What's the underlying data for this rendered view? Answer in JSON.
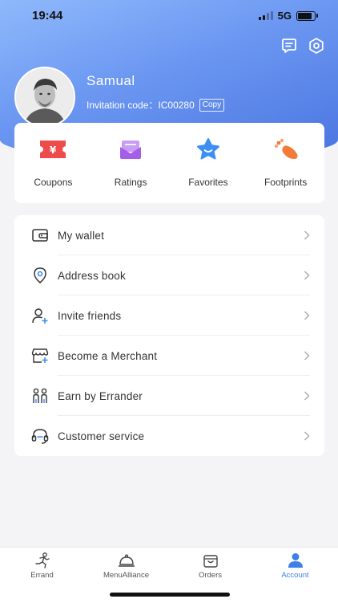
{
  "status_bar": {
    "time": "19:44",
    "network": "5G"
  },
  "header": {
    "top_icons": [
      "message-icon",
      "settings-icon"
    ],
    "username": "Samual",
    "invitation_label": "Invitation code：",
    "invitation_code": "IC00280",
    "copy_label": "Copy"
  },
  "quick_actions": [
    {
      "label": "Coupons",
      "icon": "coupon-icon"
    },
    {
      "label": "Ratings",
      "icon": "ratings-envelope-icon"
    },
    {
      "label": "Favorites",
      "icon": "favorites-star-icon"
    },
    {
      "label": "Footprints",
      "icon": "footprints-icon"
    }
  ],
  "menu": [
    {
      "label": "My wallet",
      "icon": "wallet-icon"
    },
    {
      "label": "Address book",
      "icon": "location-pin-icon"
    },
    {
      "label": "Invite friends",
      "icon": "invite-user-icon"
    },
    {
      "label": "Become a Merchant",
      "icon": "merchant-store-icon"
    },
    {
      "label": "Earn by Errander",
      "icon": "errander-people-icon"
    },
    {
      "label": "Customer service",
      "icon": "headset-icon"
    }
  ],
  "tabs": [
    {
      "label": "Errand",
      "icon": "runner-icon",
      "active": false
    },
    {
      "label": "MenuAlliance",
      "icon": "cloche-icon",
      "active": false
    },
    {
      "label": "Orders",
      "icon": "shopping-bag-icon",
      "active": false
    },
    {
      "label": "Account",
      "icon": "account-user-icon",
      "active": true
    }
  ],
  "colors": {
    "header_gradient_start": "#8fb9fb",
    "header_gradient_end": "#4a74e0",
    "active_tab": "#3f7fe8",
    "coupon": "#ee4b4b",
    "ratings": "#a45ee8",
    "favorites": "#3d8ef5",
    "footprints": "#f47a3a"
  }
}
